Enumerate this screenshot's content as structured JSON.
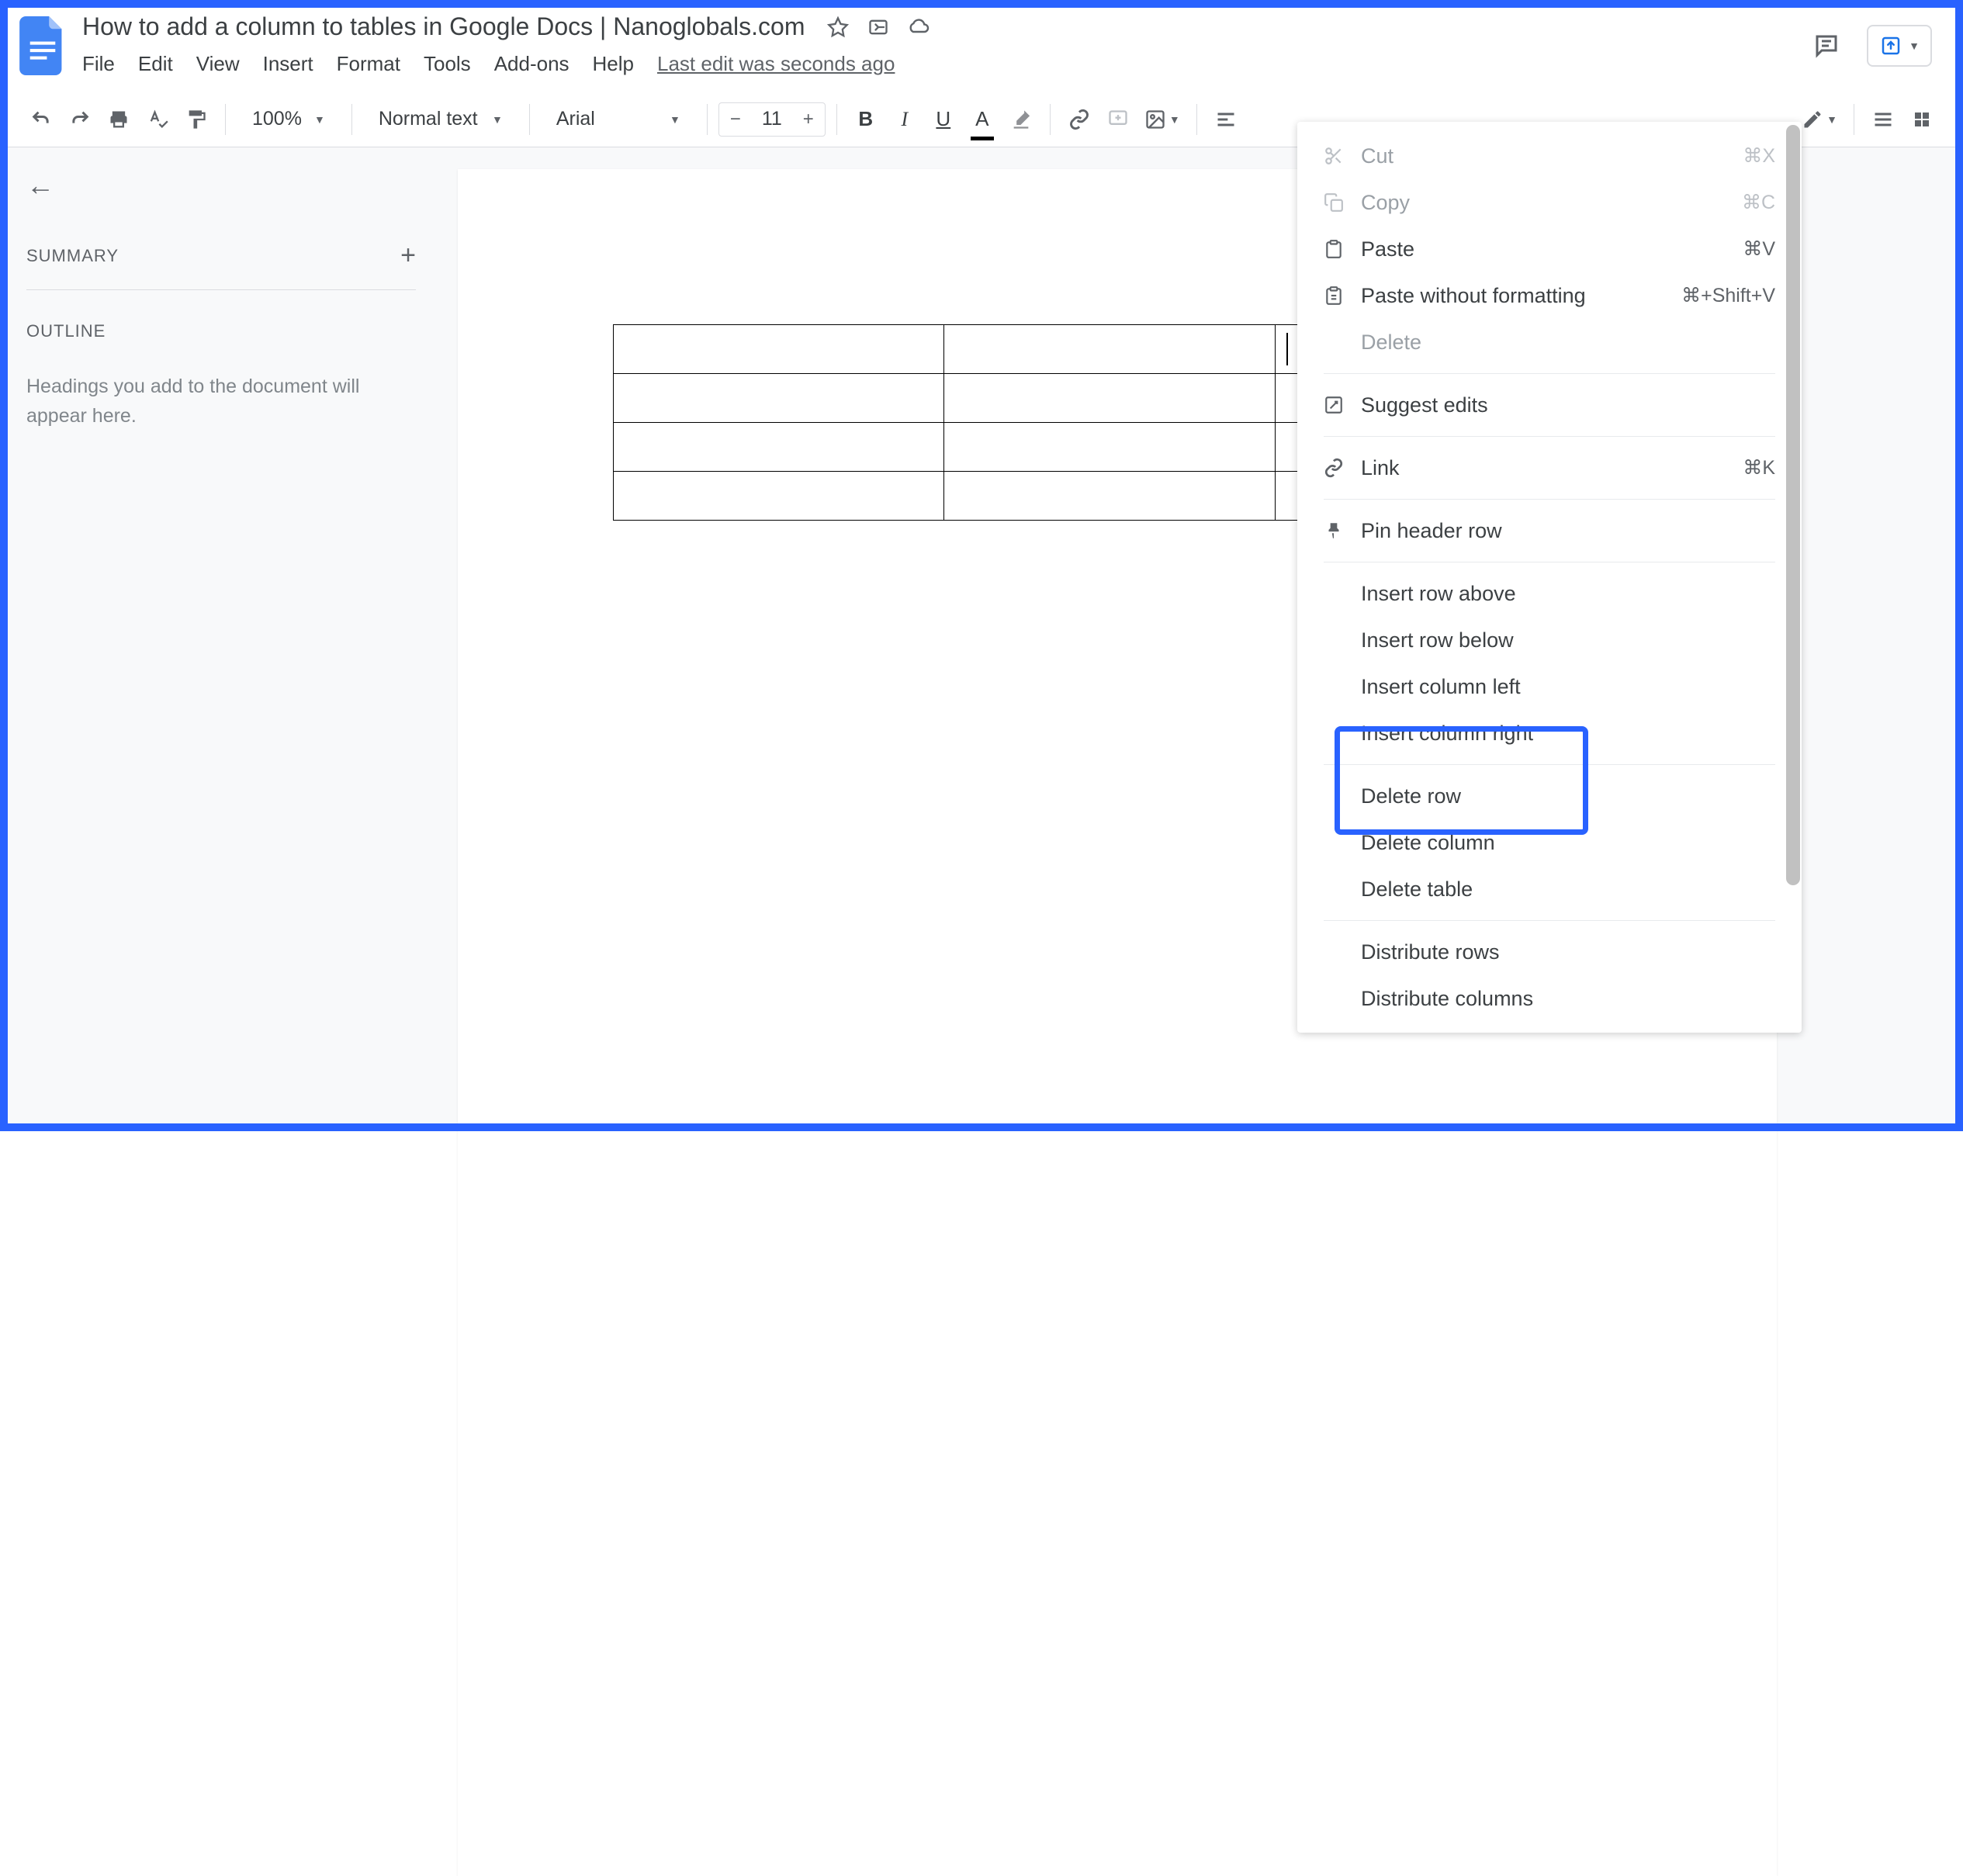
{
  "doc_title": "How to add a column to tables in Google Docs | Nanoglobals.com",
  "menus": [
    "File",
    "Edit",
    "View",
    "Insert",
    "Format",
    "Tools",
    "Add-ons",
    "Help"
  ],
  "last_edit": "Last edit was seconds ago",
  "toolbar": {
    "zoom": "100%",
    "style": "Normal text",
    "font": "Arial",
    "font_size": "11"
  },
  "sidebar": {
    "summary": "SUMMARY",
    "outline": "OUTLINE",
    "outline_hint": "Headings you add to the document will appear here."
  },
  "context_menu": {
    "cut": {
      "label": "Cut",
      "shortcut": "⌘X"
    },
    "copy": {
      "label": "Copy",
      "shortcut": "⌘C"
    },
    "paste": {
      "label": "Paste",
      "shortcut": "⌘V"
    },
    "paste_wo": {
      "label": "Paste without formatting",
      "shortcut": "⌘+Shift+V"
    },
    "delete": {
      "label": "Delete"
    },
    "suggest": {
      "label": "Suggest edits"
    },
    "link": {
      "label": "Link",
      "shortcut": "⌘K"
    },
    "pin": {
      "label": "Pin header row"
    },
    "row_above": {
      "label": "Insert row above"
    },
    "row_below": {
      "label": "Insert row below"
    },
    "col_left": {
      "label": "Insert column left"
    },
    "col_right": {
      "label": "Insert column right"
    },
    "del_row": {
      "label": "Delete row"
    },
    "del_col": {
      "label": "Delete column"
    },
    "del_table": {
      "label": "Delete table"
    },
    "dist_rows": {
      "label": "Distribute rows"
    },
    "dist_cols": {
      "label": "Distribute columns"
    }
  }
}
